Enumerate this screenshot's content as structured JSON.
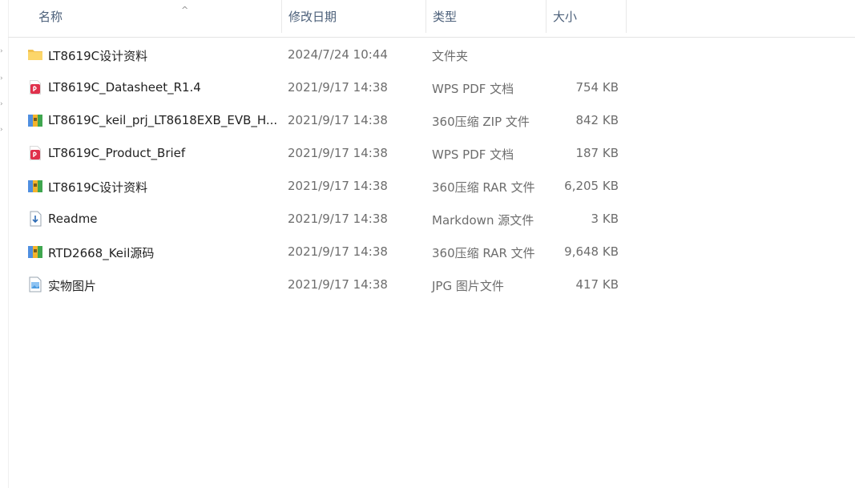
{
  "columns": {
    "name": "名称",
    "date": "修改日期",
    "type": "类型",
    "size": "大小"
  },
  "sort_indicator": "^",
  "files": [
    {
      "name": "LT8619C设计资料",
      "date": "2024/7/24 10:44",
      "type": "文件夹",
      "size": "",
      "icon": "folder-icon"
    },
    {
      "name": "LT8619C_Datasheet_R1.4",
      "date": "2021/9/17 14:38",
      "type": "WPS PDF 文档",
      "size": "754 KB",
      "icon": "pdf-file-icon"
    },
    {
      "name": "LT8619C_keil_prj_LT8618EXB_EVB_H...",
      "date": "2021/9/17 14:38",
      "type": "360压缩 ZIP 文件",
      "size": "842 KB",
      "icon": "archive-file-icon"
    },
    {
      "name": "LT8619C_Product_Brief",
      "date": "2021/9/17 14:38",
      "type": "WPS PDF 文档",
      "size": "187 KB",
      "icon": "pdf-file-icon"
    },
    {
      "name": "LT8619C设计资料",
      "date": "2021/9/17 14:38",
      "type": "360压缩 RAR 文件",
      "size": "6,205 KB",
      "icon": "archive-file-icon"
    },
    {
      "name": "Readme",
      "date": "2021/9/17 14:38",
      "type": "Markdown 源文件",
      "size": "3 KB",
      "icon": "markdown-file-icon"
    },
    {
      "name": "RTD2668_Keil源码",
      "date": "2021/9/17 14:38",
      "type": "360压缩 RAR 文件",
      "size": "9,648 KB",
      "icon": "archive-file-icon"
    },
    {
      "name": "实物图片",
      "date": "2021/9/17 14:38",
      "type": "JPG 图片文件",
      "size": "417 KB",
      "icon": "image-file-icon"
    }
  ]
}
